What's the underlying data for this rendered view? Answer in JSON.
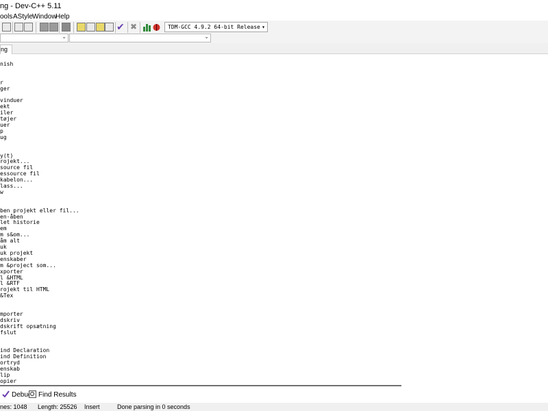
{
  "window": {
    "title": "ng - Dev-C++ 5.11"
  },
  "menu": {
    "items": [
      "ools",
      "AStyle",
      "Window",
      "Help"
    ]
  },
  "toolbar": {
    "compiler": "TDM-GCC 4.9.2 64-bit Release"
  },
  "editor_tab": {
    "label": "ng"
  },
  "editor": {
    "lines": [
      {
        "row": 1,
        "text": "nish"
      },
      {
        "row": 4,
        "text": "r"
      },
      {
        "row": 5,
        "text": "ger"
      },
      {
        "row": 7,
        "text": "vinduer"
      },
      {
        "row": 8,
        "text": "ekt"
      },
      {
        "row": 9,
        "text": "iler"
      },
      {
        "row": 10,
        "text": "tøjer"
      },
      {
        "row": 11,
        "text": "uer"
      },
      {
        "row": 12,
        "text": "p"
      },
      {
        "row": 13,
        "text": "ug"
      },
      {
        "row": 16,
        "text": "y(t)"
      },
      {
        "row": 17,
        "text": "rojekt..."
      },
      {
        "row": 18,
        "text": "source fil"
      },
      {
        "row": 19,
        "text": "essource fil"
      },
      {
        "row": 20,
        "text": "kabelon..."
      },
      {
        "row": 21,
        "text": "lass..."
      },
      {
        "row": 22,
        "text": "w"
      },
      {
        "row": 25,
        "text": "ben projekt eller fil..."
      },
      {
        "row": 26,
        "text": "en-åben"
      },
      {
        "row": 27,
        "text": "let historie"
      },
      {
        "row": 28,
        "text": "em"
      },
      {
        "row": 29,
        "text": "m s&om..."
      },
      {
        "row": 30,
        "text": "åm alt"
      },
      {
        "row": 31,
        "text": "uk"
      },
      {
        "row": 32,
        "text": "uk projekt"
      },
      {
        "row": 33,
        "text": "enskaber"
      },
      {
        "row": 34,
        "text": "m &project som..."
      },
      {
        "row": 35,
        "text": "xporter"
      },
      {
        "row": 36,
        "text": "l &HTML"
      },
      {
        "row": 37,
        "text": "l &RTF"
      },
      {
        "row": 38,
        "text": "rojekt til HTML"
      },
      {
        "row": 39,
        "text": "&Tex"
      },
      {
        "row": 42,
        "text": "mporter"
      },
      {
        "row": 43,
        "text": "dskriv"
      },
      {
        "row": 44,
        "text": "dskrift opsætning"
      },
      {
        "row": 45,
        "text": "fslut"
      },
      {
        "row": 48,
        "text": "ind Declaration"
      },
      {
        "row": 49,
        "text": "ind Definition"
      },
      {
        "row": 50,
        "text": "ortryd"
      },
      {
        "row": 51,
        "text": "enskab"
      },
      {
        "row": 52,
        "text": "lip"
      },
      {
        "row": 53,
        "text": "opier"
      }
    ]
  },
  "bottom_tabs": {
    "debug": "Debug",
    "find_results": "Find Results"
  },
  "status": {
    "lines": "nes:  1048",
    "length": "Length:  25526",
    "mode": "Insert",
    "parse": "Done parsing in 0 seconds"
  },
  "colors": {
    "accent_check": "#6a3fb0",
    "bug_red": "#d0302a",
    "chart_green": "#2f8a3a"
  }
}
